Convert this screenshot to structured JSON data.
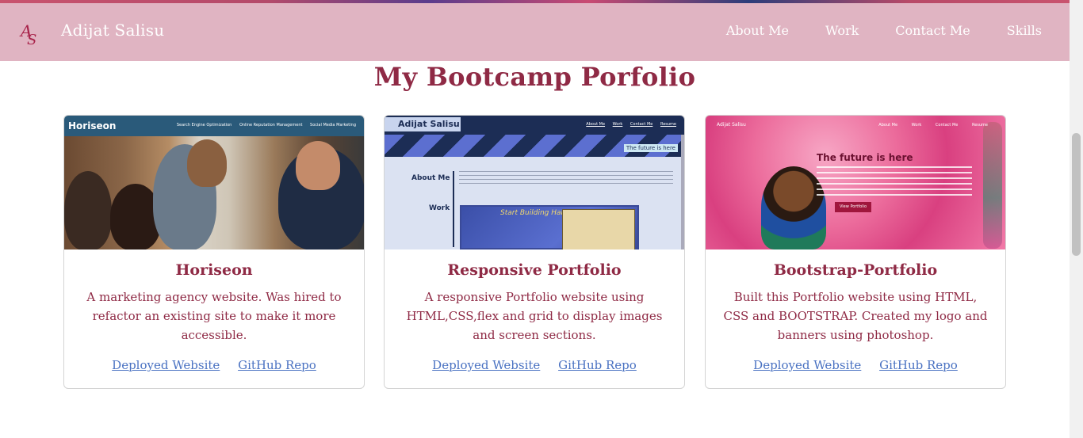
{
  "navbar": {
    "brand": "Adijat Salisu",
    "logo_text": "AS",
    "links": [
      "About Me",
      "Work",
      "Contact Me",
      "Skills"
    ]
  },
  "section": {
    "title": "My Bootcamp Porfolio"
  },
  "cards": [
    {
      "title": "Horiseon",
      "description": "A marketing agency website. Was hired to refactor an existing site to make it more accessible.",
      "links": [
        "Deployed Website",
        "GitHub Repo"
      ],
      "thumb": {
        "logo": "Horiseon",
        "nav": [
          "Search Engine Optimization",
          "Online Reputation Management",
          "Social Media Marketing"
        ]
      }
    },
    {
      "title": "Responsive Portfolio",
      "description": "A responsive Portfolio website using HTML,CSS,flex and grid to display images and screen sections.",
      "links": [
        "Deployed Website",
        "GitHub Repo"
      ],
      "thumb": {
        "name": "Adijat Salisu",
        "nav": [
          "About Me",
          "Work",
          "Contact Me",
          "Resume"
        ],
        "banner": "The future is here",
        "about": "About Me",
        "work": "Work",
        "project": "Start Building Habits."
      }
    },
    {
      "title": "Bootstrap-Portfolio",
      "description": "Built this Portfolio website using HTML, CSS and BOOTSTRAP. Created my logo and banners using photoshop.",
      "links": [
        "Deployed Website",
        "GitHub Repo"
      ],
      "thumb": {
        "name": "Adijat Salisu",
        "nav": [
          "About Me",
          "Work",
          "Contact Me",
          "Resume"
        ],
        "headline": "The future is here",
        "button": "View Portfolio"
      }
    }
  ],
  "colors": {
    "navbar_bg": "#e0b4c2",
    "heading": "#8f2a45",
    "link": "#4a72c2"
  }
}
